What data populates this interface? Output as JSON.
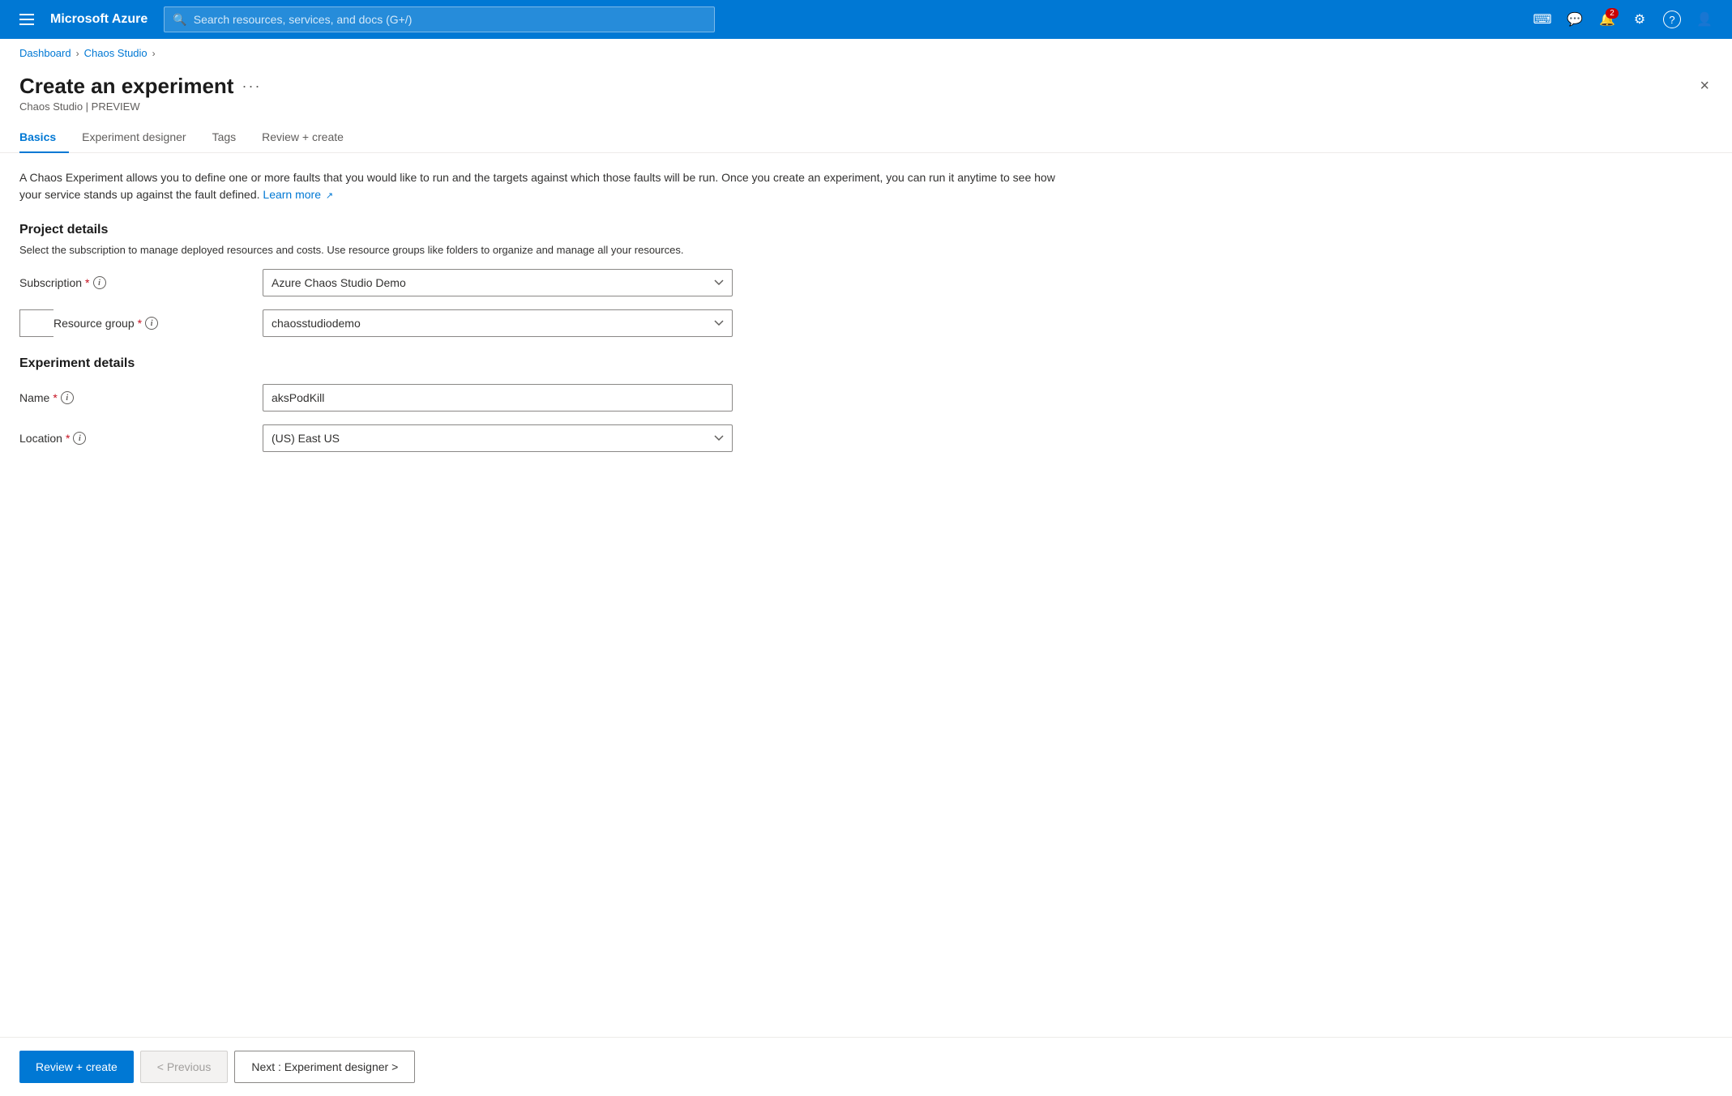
{
  "topnav": {
    "hamburger_label": "Menu",
    "brand": "Microsoft Azure",
    "search_placeholder": "Search resources, services, and docs (G+/)",
    "icons": [
      {
        "name": "cloud-shell-icon",
        "symbol": "⌨"
      },
      {
        "name": "feedback-icon",
        "symbol": "💬"
      },
      {
        "name": "notifications-icon",
        "symbol": "🔔",
        "badge": "2"
      },
      {
        "name": "settings-icon",
        "symbol": "⚙"
      },
      {
        "name": "help-icon",
        "symbol": "?"
      },
      {
        "name": "account-icon",
        "symbol": "👤"
      }
    ]
  },
  "breadcrumb": {
    "items": [
      {
        "label": "Dashboard",
        "href": "#"
      },
      {
        "label": "Chaos Studio",
        "href": "#"
      }
    ]
  },
  "page": {
    "title": "Create an experiment",
    "subtitle": "Chaos Studio | PREVIEW",
    "more_label": "···",
    "close_label": "×"
  },
  "tabs": [
    {
      "label": "Basics",
      "active": true
    },
    {
      "label": "Experiment designer",
      "active": false
    },
    {
      "label": "Tags",
      "active": false
    },
    {
      "label": "Review + create",
      "active": false
    }
  ],
  "info_text": "A Chaos Experiment allows you to define one or more faults that you would like to run and the targets against which those faults will be run. Once you create an experiment, you can run it anytime to see how your service stands up against the fault defined.",
  "learn_more_label": "Learn more",
  "sections": {
    "project_details": {
      "title": "Project details",
      "desc": "Select the subscription to manage deployed resources and costs. Use resource groups like folders to organize and manage all your resources.",
      "fields": [
        {
          "label": "Subscription",
          "required": true,
          "has_info": true,
          "type": "select",
          "value": "Azure Chaos Studio Demo",
          "options": [
            "Azure Chaos Studio Demo"
          ]
        },
        {
          "label": "Resource group",
          "required": true,
          "has_info": true,
          "type": "select",
          "value": "chaosstudiodemo",
          "options": [
            "chaosstudiodemo"
          ]
        }
      ]
    },
    "experiment_details": {
      "title": "Experiment details",
      "fields": [
        {
          "label": "Name",
          "required": true,
          "has_info": true,
          "type": "input",
          "value": "aksPodKill"
        },
        {
          "label": "Location",
          "required": true,
          "has_info": true,
          "type": "select",
          "value": "(US) East US",
          "options": [
            "(US) East US"
          ]
        }
      ]
    }
  },
  "footer": {
    "review_create_label": "Review + create",
    "previous_label": "< Previous",
    "next_label": "Next : Experiment designer >"
  }
}
